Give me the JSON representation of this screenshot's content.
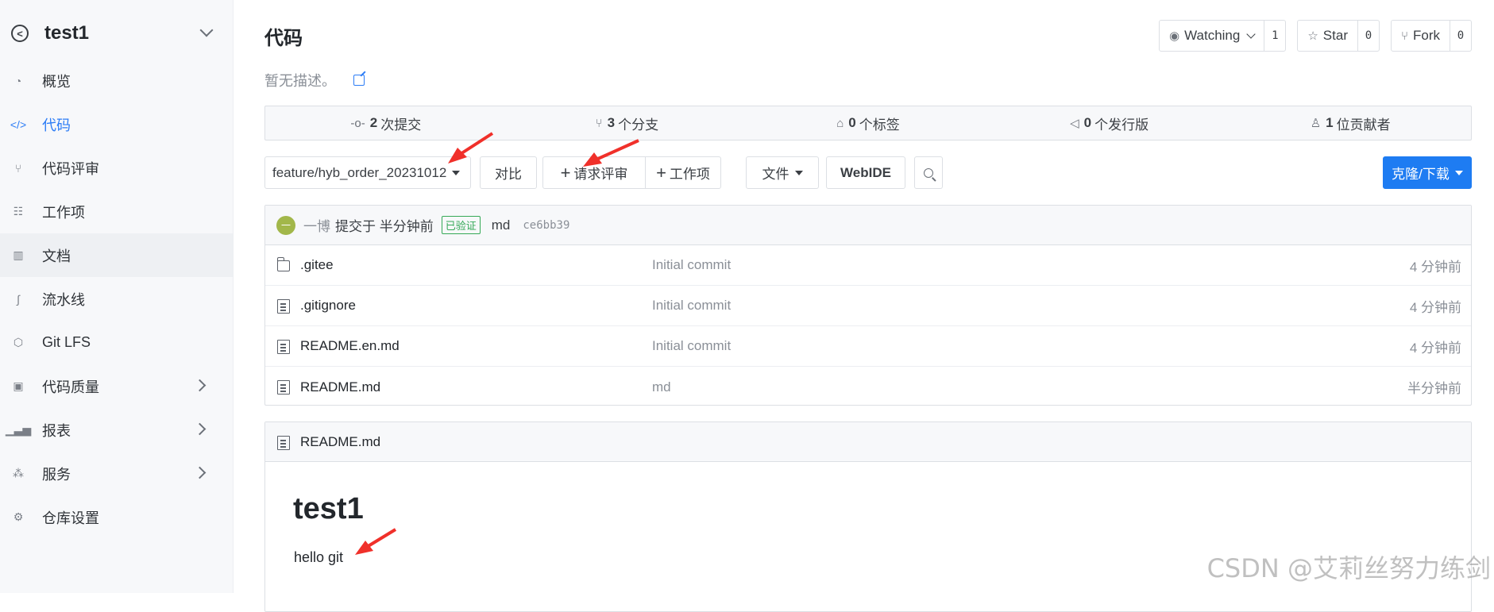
{
  "sidebar": {
    "repo_name": "test1",
    "items": [
      {
        "label": "概览",
        "icon": "dashboard-icon"
      },
      {
        "label": "代码",
        "icon": "code-icon"
      },
      {
        "label": "代码评审",
        "icon": "pull-request-icon"
      },
      {
        "label": "工作项",
        "icon": "task-icon"
      },
      {
        "label": "文档",
        "icon": "book-icon"
      },
      {
        "label": "流水线",
        "icon": "pipeline-icon"
      },
      {
        "label": "Git LFS",
        "icon": "cube-icon"
      },
      {
        "label": "代码质量",
        "icon": "quality-icon"
      },
      {
        "label": "报表",
        "icon": "bar-chart-icon"
      },
      {
        "label": "服务",
        "icon": "services-icon"
      },
      {
        "label": "仓库设置",
        "icon": "gear-icon"
      }
    ]
  },
  "header": {
    "title": "代码",
    "description": "暂无描述。"
  },
  "social": {
    "watch_label": "Watching",
    "watch_count": "1",
    "star_label": "Star",
    "star_count": "0",
    "fork_label": "Fork",
    "fork_count": "0"
  },
  "stats": {
    "commits_count": "2",
    "commits_label": "次提交",
    "branches_count": "3",
    "branches_label": "个分支",
    "tags_count": "0",
    "tags_label": "个标签",
    "releases_count": "0",
    "releases_label": "个发行版",
    "contributors_count": "1",
    "contributors_label": "位贡献者"
  },
  "toolbar": {
    "branch": "feature/hyb_order_20231012",
    "compare": "对比",
    "pull_request": "请求评审",
    "work_item": "工作项",
    "file": "文件",
    "webide": "WebIDE",
    "clone": "克隆/下载"
  },
  "commit": {
    "avatar": "一",
    "author": "一博",
    "time": "提交于 半分钟前",
    "verified": "已验证",
    "message": "md",
    "hash": "ce6bb39"
  },
  "files": [
    {
      "name": ".gitee",
      "type": "folder",
      "message": "Initial commit",
      "time": "4 分钟前"
    },
    {
      "name": ".gitignore",
      "type": "file",
      "message": "Initial commit",
      "time": "4 分钟前"
    },
    {
      "name": "README.en.md",
      "type": "file",
      "message": "Initial commit",
      "time": "4 分钟前"
    },
    {
      "name": "README.md",
      "type": "file",
      "message": "md",
      "time": "半分钟前"
    }
  ],
  "readme": {
    "file_name": "README.md",
    "heading": "test1",
    "body": "hello git"
  },
  "watermark": "CSDN @艾莉丝努力练剑",
  "colors": {
    "accent": "#2d7df6",
    "clone_button": "#1e7cf2",
    "verified": "#35a957",
    "annotation_arrow": "#f0302a"
  }
}
